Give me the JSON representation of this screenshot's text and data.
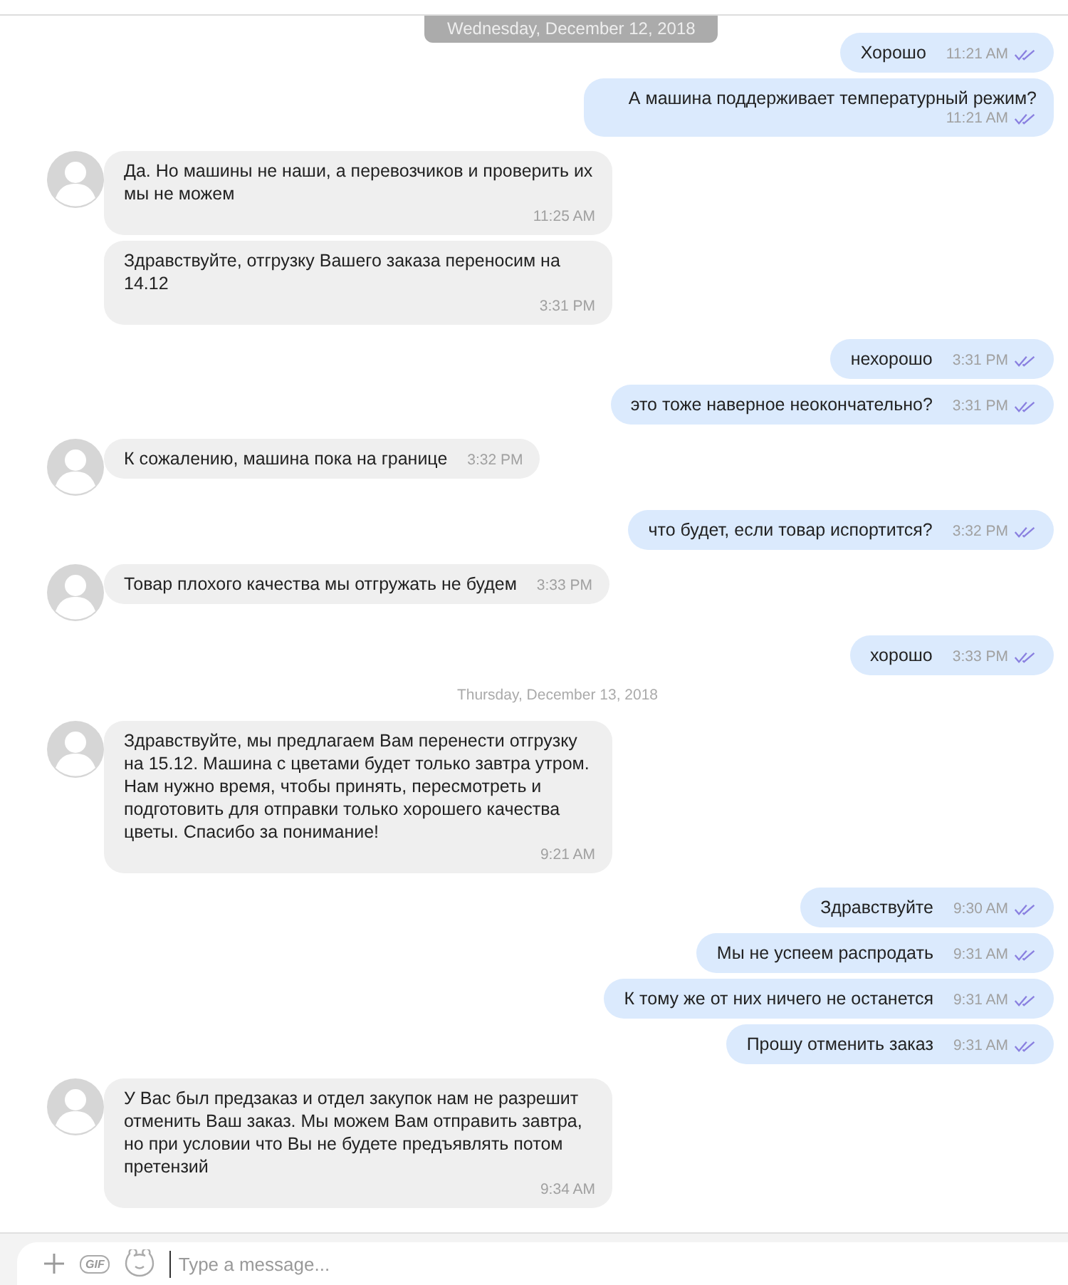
{
  "messages": [
    {
      "kind": "date-pill",
      "text": "Wednesday, December 12, 2018"
    },
    {
      "kind": "outgoing",
      "text": "Хорошо",
      "time": "11:21 AM",
      "read": true
    },
    {
      "kind": "outgoing",
      "text": "А машина поддерживает температурный режим?",
      "time": "11:21 AM",
      "read": true
    },
    {
      "kind": "incoming",
      "avatar": true,
      "text": "Да. Но машины не наши, а перевозчиков и проверить их мы не можем",
      "time": "11:25 AM"
    },
    {
      "kind": "incoming",
      "avatar": false,
      "text": "Здравствуйте, отгрузку Вашего заказа переносим на 14.12",
      "time": "3:31 PM"
    },
    {
      "kind": "outgoing",
      "text": "нехорошо",
      "time": "3:31 PM",
      "read": true
    },
    {
      "kind": "outgoing",
      "text": "это тоже наверное неокончательно?",
      "time": "3:31 PM",
      "read": true
    },
    {
      "kind": "incoming",
      "avatar": true,
      "text": "К сожалению, машина пока на границе",
      "time": "3:32 PM"
    },
    {
      "kind": "outgoing",
      "text": "что будет, если товар испортится?",
      "time": "3:32 PM",
      "read": true
    },
    {
      "kind": "incoming",
      "avatar": true,
      "text": "Товар плохого качества мы отгружать не будем",
      "time": "3:33 PM"
    },
    {
      "kind": "outgoing",
      "text": "хорошо",
      "time": "3:33 PM",
      "read": true
    },
    {
      "kind": "date",
      "text": "Thursday, December 13, 2018"
    },
    {
      "kind": "incoming",
      "avatar": true,
      "text": "Здравствуйте, мы предлагаем Вам перенести отгрузку на 15.12. Машина с цветами будет только завтра утром. Нам нужно время, чтобы принять, пересмотреть и подготовить для отправки только хорошего качества  цветы. Спасибо за понимание!",
      "time": "9:21 AM"
    },
    {
      "kind": "outgoing",
      "text": "Здравствуйте",
      "time": "9:30 AM",
      "read": true
    },
    {
      "kind": "outgoing",
      "text": "Мы не успеем распродать",
      "time": "9:31 AM",
      "read": true
    },
    {
      "kind": "outgoing",
      "text": "К тому же от них ничего не останется",
      "time": "9:31 AM",
      "read": true
    },
    {
      "kind": "outgoing",
      "text": "Прошу отменить заказ",
      "time": "9:31 AM",
      "read": true
    },
    {
      "kind": "incoming",
      "avatar": true,
      "text": "У Вас был предзаказ и отдел закупок нам не разрешит отменить Ваш заказ. Мы можем Вам отправить завтра, но при условии что Вы не будете предъявлять потом претензий",
      "time": "9:34 AM"
    }
  ],
  "composer": {
    "gif_label": "GIF",
    "placeholder": "Type a message..."
  }
}
